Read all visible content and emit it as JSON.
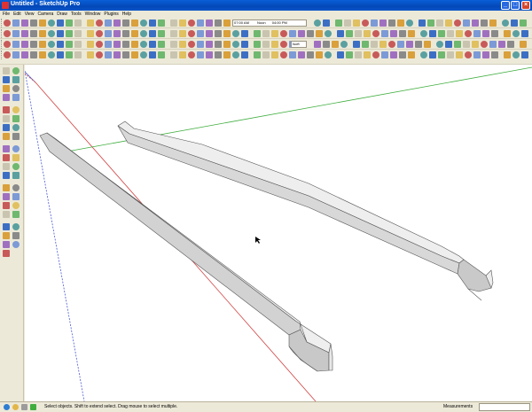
{
  "app": {
    "title": "Untitled - SketchUp Pro"
  },
  "window_buttons": {
    "minimize": "_",
    "maximize": "□",
    "close": "×"
  },
  "menu": [
    "File",
    "Edit",
    "View",
    "Camera",
    "Draw",
    "Tools",
    "Window",
    "Plugins",
    "Help"
  ],
  "toolbar": {
    "shadow_time": "07:00 AM",
    "shadow_noon": "Noon",
    "shadow_date": "04:00 PM",
    "style_label": "Isoft"
  },
  "status": {
    "message": "Select objects. Shift to extend select. Drag mouse to select multiple.",
    "measurements_label": "Measurements",
    "measurements_value": ""
  },
  "colors": {
    "titlebar": "#0348b8",
    "chrome": "#ece9d8",
    "viewport": "#ffffff",
    "red_axis": "#d04040",
    "green_axis": "#3fae3f",
    "blue_axis": "#4a5ad0",
    "model_face": "#e4e4e4"
  }
}
